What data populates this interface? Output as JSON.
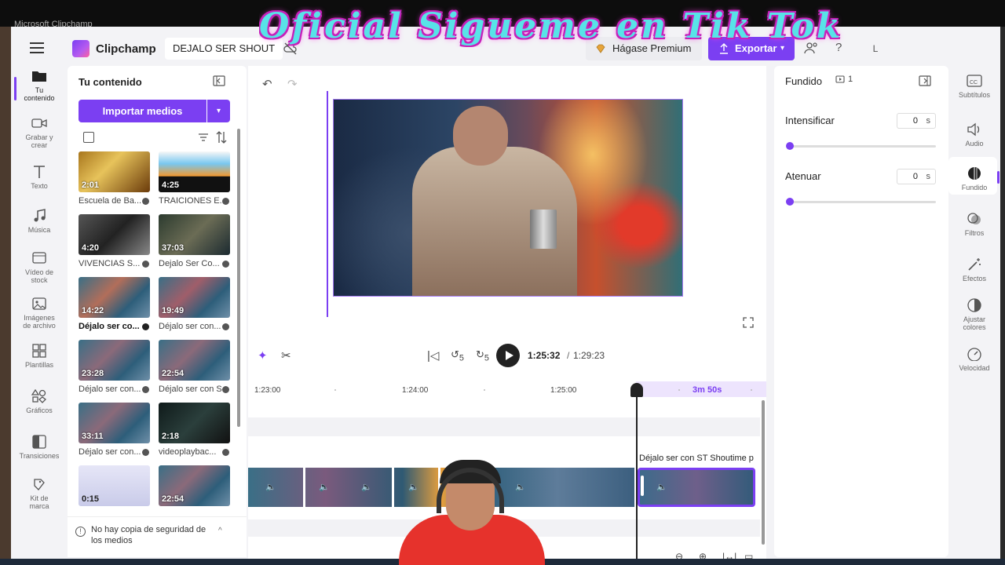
{
  "os": {
    "window_title": "Microsoft Clipchamp"
  },
  "overlay": {
    "banner_text": "Oficial Sigueme en Tik Tok"
  },
  "header": {
    "app_name": "Clipchamp",
    "project_title": "DEJALO SER SHOUT",
    "premium_label": "Hágase Premium",
    "export_label": "Exportar",
    "help_label": "?",
    "avatar_initial": "L"
  },
  "left_rail": {
    "items": [
      {
        "label_line1": "Tu",
        "label_line2": "contenido",
        "icon": "folder-icon"
      },
      {
        "label_line1": "Grabar y",
        "label_line2": "crear",
        "icon": "camera-icon"
      },
      {
        "label_line1": "Texto",
        "label_line2": "",
        "icon": "text-icon"
      },
      {
        "label_line1": "Música",
        "label_line2": "",
        "icon": "music-icon"
      },
      {
        "label_line1": "Vídeo de",
        "label_line2": "stock",
        "icon": "stock-video-icon"
      },
      {
        "label_line1": "Imágenes",
        "label_line2": "de archivo",
        "icon": "image-icon"
      },
      {
        "label_line1": "Plantillas",
        "label_line2": "",
        "icon": "templates-icon"
      },
      {
        "label_line1": "Gráficos",
        "label_line2": "",
        "icon": "shapes-icon"
      },
      {
        "label_line1": "Transiciones",
        "label_line2": "",
        "icon": "transitions-icon"
      },
      {
        "label_line1": "Kit de",
        "label_line2": "marca",
        "icon": "brand-kit-icon"
      }
    ]
  },
  "content_panel": {
    "title": "Tu contenido",
    "import_label": "Importar medios",
    "media": [
      {
        "duration": "2:01",
        "caption": "Escuela de Ba...",
        "bold": false
      },
      {
        "duration": "4:25",
        "caption": "TRAICIONES E...",
        "bold": false
      },
      {
        "duration": "4:20",
        "caption": "VIVENCIAS S...",
        "bold": false
      },
      {
        "duration": "37:03",
        "caption": "Dejalo Ser Co...",
        "bold": false
      },
      {
        "duration": "14:22",
        "caption": "Déjalo ser co...",
        "bold": true
      },
      {
        "duration": "19:49",
        "caption": "Déjalo ser con...",
        "bold": false
      },
      {
        "duration": "23:28",
        "caption": "Déjalo ser con...",
        "bold": false
      },
      {
        "duration": "22:54",
        "caption": "Déjalo ser con S...",
        "bold": false
      },
      {
        "duration": "33:11",
        "caption": "Déjalo ser con...",
        "bold": false
      },
      {
        "duration": "2:18",
        "caption": "videoplaybac...",
        "bold": false
      },
      {
        "duration": "0:15",
        "caption": "",
        "bold": false
      },
      {
        "duration": "22:54",
        "caption": "",
        "bold": false
      }
    ],
    "backup_note": "No hay copia de seguridad de los medios"
  },
  "transport": {
    "current_time": "1:25:32",
    "separator": "/",
    "total_time": "1:29:23",
    "rewind_label": "5",
    "forward_label": "5"
  },
  "timeline": {
    "ticks": [
      "1:23:00",
      "1:24:00",
      "1:25:00"
    ],
    "selection_duration": "3m 50s",
    "selected_clip_label": "Déjalo ser con ST Shoutime p"
  },
  "properties": {
    "title": "Fundido",
    "count": "1",
    "fade_in_label": "Intensificar",
    "fade_in_value": "0",
    "fade_out_label": "Atenuar",
    "fade_out_value": "0",
    "unit": "s"
  },
  "right_rail": {
    "items": [
      {
        "label_line1": "Subtítulos",
        "label_line2": "",
        "icon": "captions-icon"
      },
      {
        "label_line1": "Audio",
        "label_line2": "",
        "icon": "speaker-icon"
      },
      {
        "label_line1": "Fundido",
        "label_line2": "",
        "icon": "fade-icon"
      },
      {
        "label_line1": "Filtros",
        "label_line2": "",
        "icon": "filters-icon"
      },
      {
        "label_line1": "Efectos",
        "label_line2": "",
        "icon": "effects-wand-icon"
      },
      {
        "label_line1": "Ajustar",
        "label_line2": "colores",
        "icon": "adjust-colors-icon"
      },
      {
        "label_line1": "Velocidad",
        "label_line2": "",
        "icon": "speed-gauge-icon"
      }
    ]
  },
  "colors": {
    "accent": "#7b3ff2",
    "banner_cyan": "#58e3e8",
    "banner_magenta": "#c420b8"
  }
}
